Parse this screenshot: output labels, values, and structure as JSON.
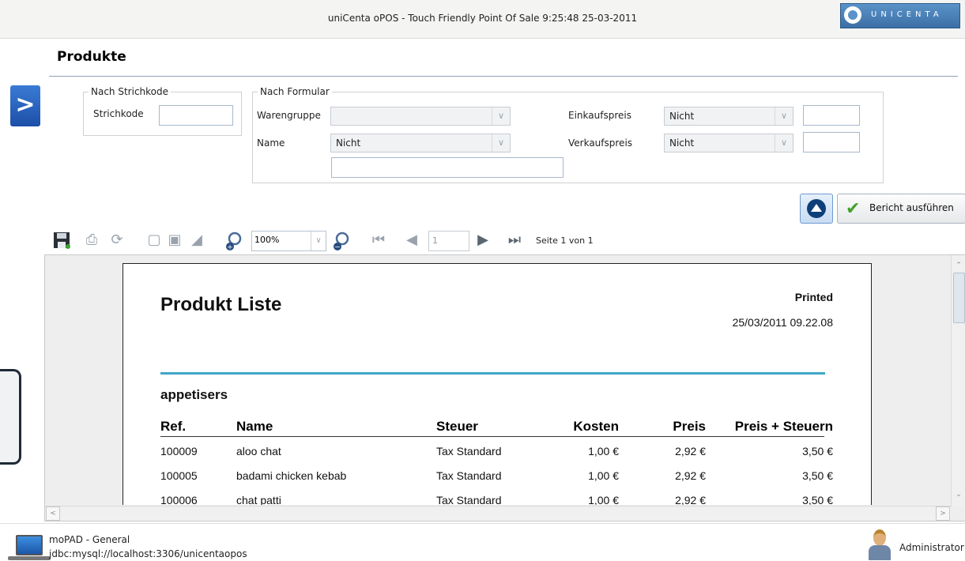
{
  "window": {
    "title": "uniCenta oPOS - Touch Friendly Point Of Sale  9:25:48  25-03-2011",
    "logo_text": "UNICENTA"
  },
  "page": {
    "title": "Produkte"
  },
  "filters": {
    "barcode_group": {
      "legend": "Nach Strichkode",
      "barcode_label": "Strichkode",
      "barcode_value": ""
    },
    "form_group": {
      "legend": "Nach Formular",
      "category_label": "Warengruppe",
      "category_value": "",
      "name_label": "Name",
      "name_op": "Nicht",
      "name_value": "",
      "buy_price_label": "Einkaufspreis",
      "buy_price_op": "Nicht",
      "buy_price_value": "",
      "sell_price_label": "Verkaufspreis",
      "sell_price_op": "Nicht",
      "sell_price_value": ""
    }
  },
  "actions": {
    "run_report_label": "Bericht ausführen"
  },
  "toolbar": {
    "zoom": "100%",
    "page_number": "1",
    "page_of": "Seite 1 von 1"
  },
  "report": {
    "title": "Produkt Liste",
    "printed_label": "Printed",
    "printed_date": "25/03/2011 09.22.08",
    "group": "appetisers",
    "columns": [
      "Ref.",
      "Name",
      "Steuer",
      "Kosten",
      "Preis",
      "Preis + Steuern"
    ],
    "rows": [
      [
        "100009",
        "aloo chat",
        "Tax Standard",
        "1,00 €",
        "2,92 €",
        "3,50 €"
      ],
      [
        "100005",
        "badami chicken kebab",
        "Tax Standard",
        "1,00 €",
        "2,92 €",
        "3,50 €"
      ],
      [
        "100006",
        "chat patti",
        "Tax Standard",
        "1,00 €",
        "2,92 €",
        "3,50 €"
      ]
    ]
  },
  "status": {
    "line1": "moPAD - General",
    "line2": "jdbc:mysql://localhost:3306/unicentaopos",
    "user": "Administrator"
  },
  "icons": {
    "toggle": "chevron-right-icon",
    "run": "checkmark-icon",
    "collapse": "collapse-up-icon"
  }
}
